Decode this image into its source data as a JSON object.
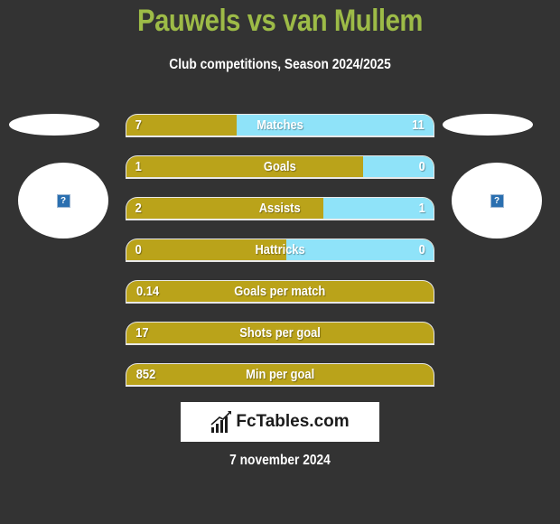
{
  "header": {
    "title": "Pauwels vs van Mullem",
    "subtitle": "Club competitions, Season 2024/2025"
  },
  "players": {
    "left": {
      "avatar_icon": "broken-image-icon",
      "placeholder_glyph": "?"
    },
    "right": {
      "avatar_icon": "broken-image-icon",
      "placeholder_glyph": "?"
    }
  },
  "colors": {
    "title": "#9dbb47",
    "left_bar": "#baa31a",
    "right_bar": "#8fe3f9",
    "background": "#333333"
  },
  "stats": [
    {
      "label": "Matches",
      "left": "7",
      "right": "11",
      "left_share": 0.36
    },
    {
      "label": "Goals",
      "left": "1",
      "right": "0",
      "left_share": 0.77
    },
    {
      "label": "Assists",
      "left": "2",
      "right": "1",
      "left_share": 0.64
    },
    {
      "label": "Hattricks",
      "left": "0",
      "right": "0",
      "left_share": 0.52
    },
    {
      "label": "Goals per match",
      "left": "0.14",
      "right": "",
      "left_share": 1.0
    },
    {
      "label": "Shots per goal",
      "left": "17",
      "right": "",
      "left_share": 1.0
    },
    {
      "label": "Min per goal",
      "left": "852",
      "right": "",
      "left_share": 1.0
    }
  ],
  "footer": {
    "logo_text": "FcTables.com",
    "logo_icon": "bar-chart-trend-icon",
    "date": "7 november 2024"
  }
}
